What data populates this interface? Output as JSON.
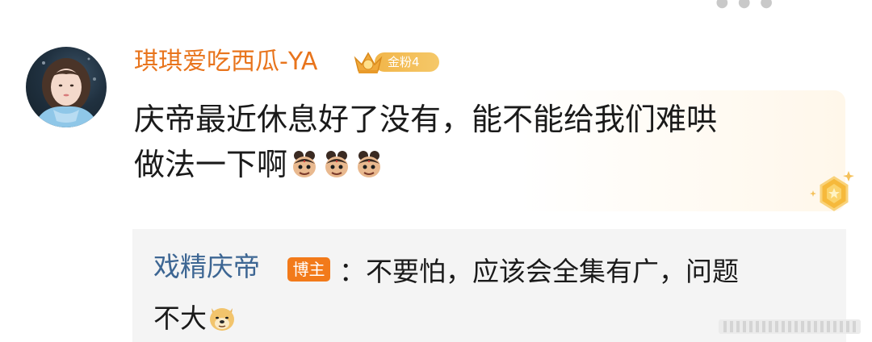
{
  "comment": {
    "username": "琪琪爱吃西瓜-YA",
    "badge_label": "金粉",
    "badge_level": "4",
    "text_line1": "庆帝最近休息好了没有，能不能给我们难哄",
    "text_line2": "做法一下啊",
    "inline_emojis": [
      "nezha-emoji",
      "nezha-emoji",
      "nezha-emoji"
    ]
  },
  "reply": {
    "author": "戏精庆帝",
    "author_tag": "博主",
    "text_part1": "：不要怕，应该会全集有广，问题",
    "text_part2": "不大",
    "emoji": "doge-emoji"
  },
  "colors": {
    "username": "#e8741c",
    "reply_author": "#3d6693",
    "blogger_tag": "#f27a1a",
    "badge": "#f2b64a"
  }
}
